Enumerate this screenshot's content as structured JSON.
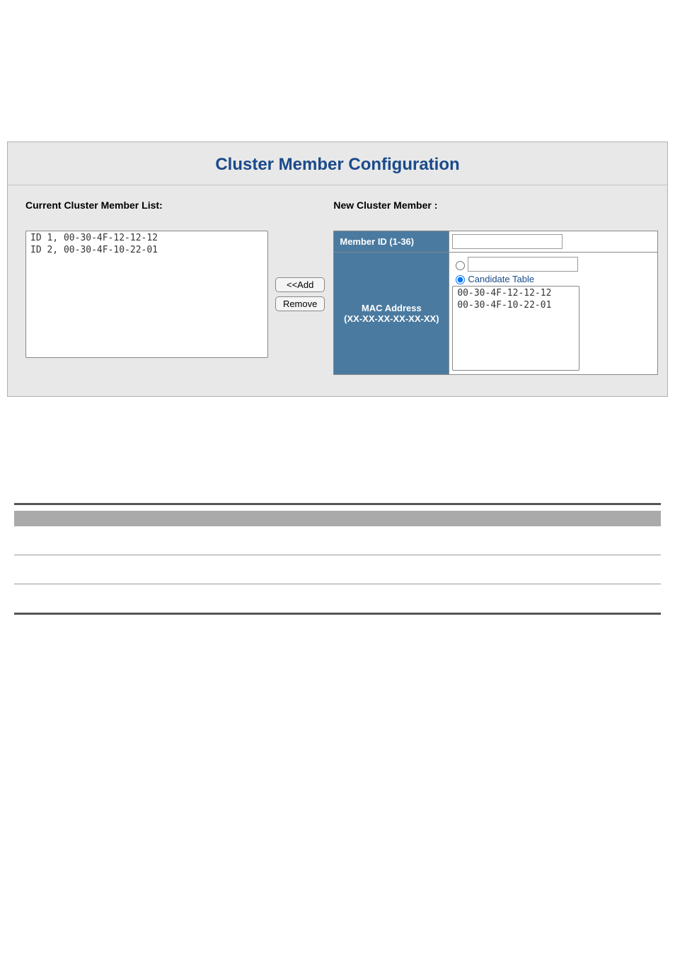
{
  "panel": {
    "title": "Cluster Member Configuration"
  },
  "current": {
    "heading": "Current Cluster Member List:",
    "members": [
      "ID 1, 00-30-4F-12-12-12",
      "ID 2, 00-30-4F-10-22-01"
    ]
  },
  "buttons": {
    "add": "<<Add",
    "remove": "Remove"
  },
  "new_member": {
    "heading": "New Cluster Member :",
    "member_id_label": "Member ID (1-36)",
    "member_id_value": "",
    "mac_label_line1": "MAC Address",
    "mac_label_line2": "(XX-XX-XX-XX-XX-XX)",
    "mac_input_value": "",
    "candidate_label": "Candidate Table",
    "candidates": [
      "00-30-4F-12-12-12",
      "00-30-4F-10-22-01"
    ]
  }
}
